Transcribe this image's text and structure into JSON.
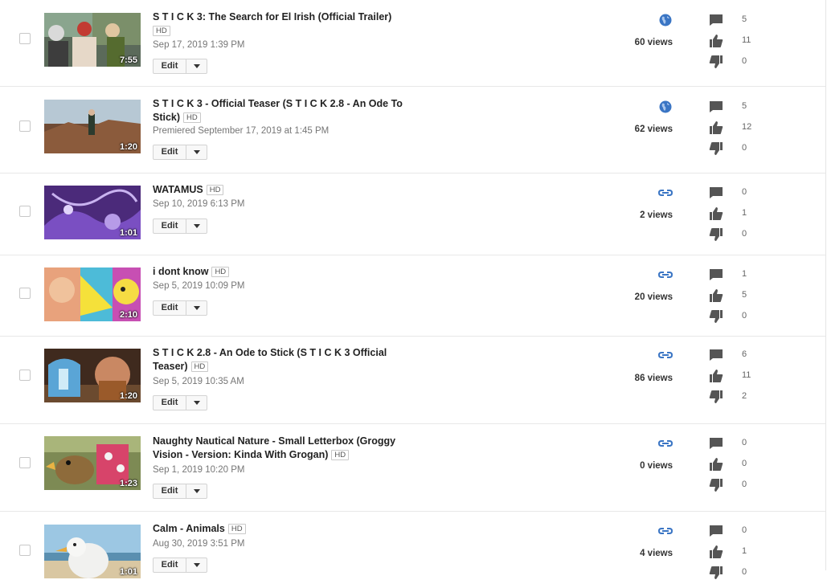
{
  "edit_label": "Edit",
  "hd_label": "HD",
  "visibility_colors": {
    "public": "#3a75c4",
    "unlisted": "#3a75c4"
  },
  "videos": [
    {
      "title": "S T I C K 3: The Search for El Irish (Official Trailer)",
      "hd": true,
      "date": "Sep 17, 2019 1:39 PM",
      "duration": "7:55",
      "visibility": "globe-icon",
      "views": "60 views",
      "comments": "5",
      "likes": "11",
      "dislikes": "0"
    },
    {
      "title": "S T I C K 3 - Official Teaser (S T I C K 2.8 - An Ode To Stick)",
      "hd": true,
      "date": "Premiered September 17, 2019 at 1:45 PM",
      "duration": "1:20",
      "visibility": "globe-icon",
      "views": "62 views",
      "comments": "5",
      "likes": "12",
      "dislikes": "0"
    },
    {
      "title": "WATAMUS",
      "hd": true,
      "date": "Sep 10, 2019 6:13 PM",
      "duration": "1:01",
      "visibility": "link-icon",
      "views": "2 views",
      "comments": "0",
      "likes": "1",
      "dislikes": "0"
    },
    {
      "title": "i dont know",
      "hd": true,
      "date": "Sep 5, 2019 10:09 PM",
      "duration": "2:10",
      "visibility": "link-icon",
      "views": "20 views",
      "comments": "1",
      "likes": "5",
      "dislikes": "0"
    },
    {
      "title": "S T I C K 2.8 - An Ode to Stick (S T I C K 3 Official Teaser)",
      "hd": true,
      "date": "Sep 5, 2019 10:35 AM",
      "duration": "1:20",
      "visibility": "link-icon",
      "views": "86 views",
      "comments": "6",
      "likes": "11",
      "dislikes": "2"
    },
    {
      "title": "Naughty Nautical Nature - Small Letterbox (Groggy Vision - Version: Kinda With Grogan)",
      "hd": true,
      "date": "Sep 1, 2019 10:20 PM",
      "duration": "1:23",
      "visibility": "link-icon",
      "views": "0 views",
      "comments": "0",
      "likes": "0",
      "dislikes": "0"
    },
    {
      "title": "Calm - Animals",
      "hd": true,
      "date": "Aug 30, 2019 3:51 PM",
      "duration": "1:01",
      "visibility": "link-icon",
      "views": "4 views",
      "comments": "0",
      "likes": "1",
      "dislikes": "0"
    }
  ]
}
